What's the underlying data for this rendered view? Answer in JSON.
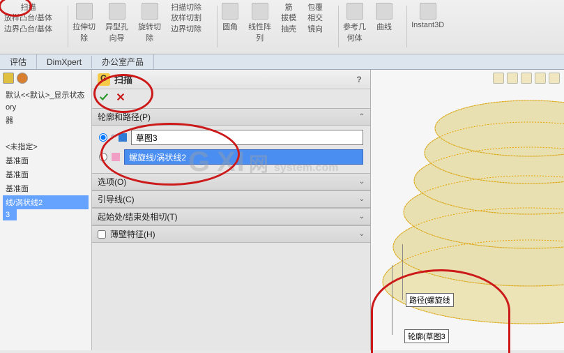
{
  "ribbon": {
    "group1": {
      "line1": "扫描",
      "line2": "放样凸台/基体",
      "line3": "边界凸台/基体"
    },
    "btn_extrude_cut": {
      "l1": "拉伸切",
      "l2": "除"
    },
    "btn_hole": {
      "l1": "异型孔",
      "l2": "向导"
    },
    "btn_rev_cut": {
      "l1": "旋转切",
      "l2": "除"
    },
    "group2": {
      "line1": "扫描切除",
      "line2": "放样切割",
      "line3": "边界切除"
    },
    "btn_fillet": "圆角",
    "btn_linpat": {
      "l1": "线性阵",
      "l2": "列"
    },
    "group3": {
      "line1": "筋",
      "line2": "拔模",
      "line3": "抽壳"
    },
    "group4": {
      "line1": "包覆",
      "line2": "相交",
      "line3": "镜向"
    },
    "btn_refgeo": {
      "l1": "参考几",
      "l2": "何体"
    },
    "btn_curve": "曲线",
    "btn_instant3d": "Instant3D"
  },
  "tabs": {
    "t1": "评估",
    "t2": "DimXpert",
    "t3": "办公室产品"
  },
  "tree": {
    "line_state": "默认<<默认>_显示状态",
    "line_ory": "ory",
    "line_qi": "器",
    "line_unspec": "<未指定>",
    "line_p1": "基准面",
    "line_p2": "基准面",
    "line_p3": "基准面",
    "sel1": "线/涡状线2",
    "sel2": "3"
  },
  "pm": {
    "title": "扫描",
    "help": "?",
    "sec_profile": "轮廓和路径(P)",
    "field_profile": "草图3",
    "field_path": "螺旋线/涡状线2",
    "sec_options": "选项(O)",
    "sec_guides": "引导线(C)",
    "sec_startend": "起始处/结束处相切(T)",
    "sec_thin": "薄壁特征(H)"
  },
  "viewport": {
    "label_path": "路径(螺旋线",
    "label_profile": "轮廓(草图3"
  },
  "watermark": {
    "big1": "G",
    "big2": "XI",
    "mid": "网",
    "small": "system.com"
  }
}
